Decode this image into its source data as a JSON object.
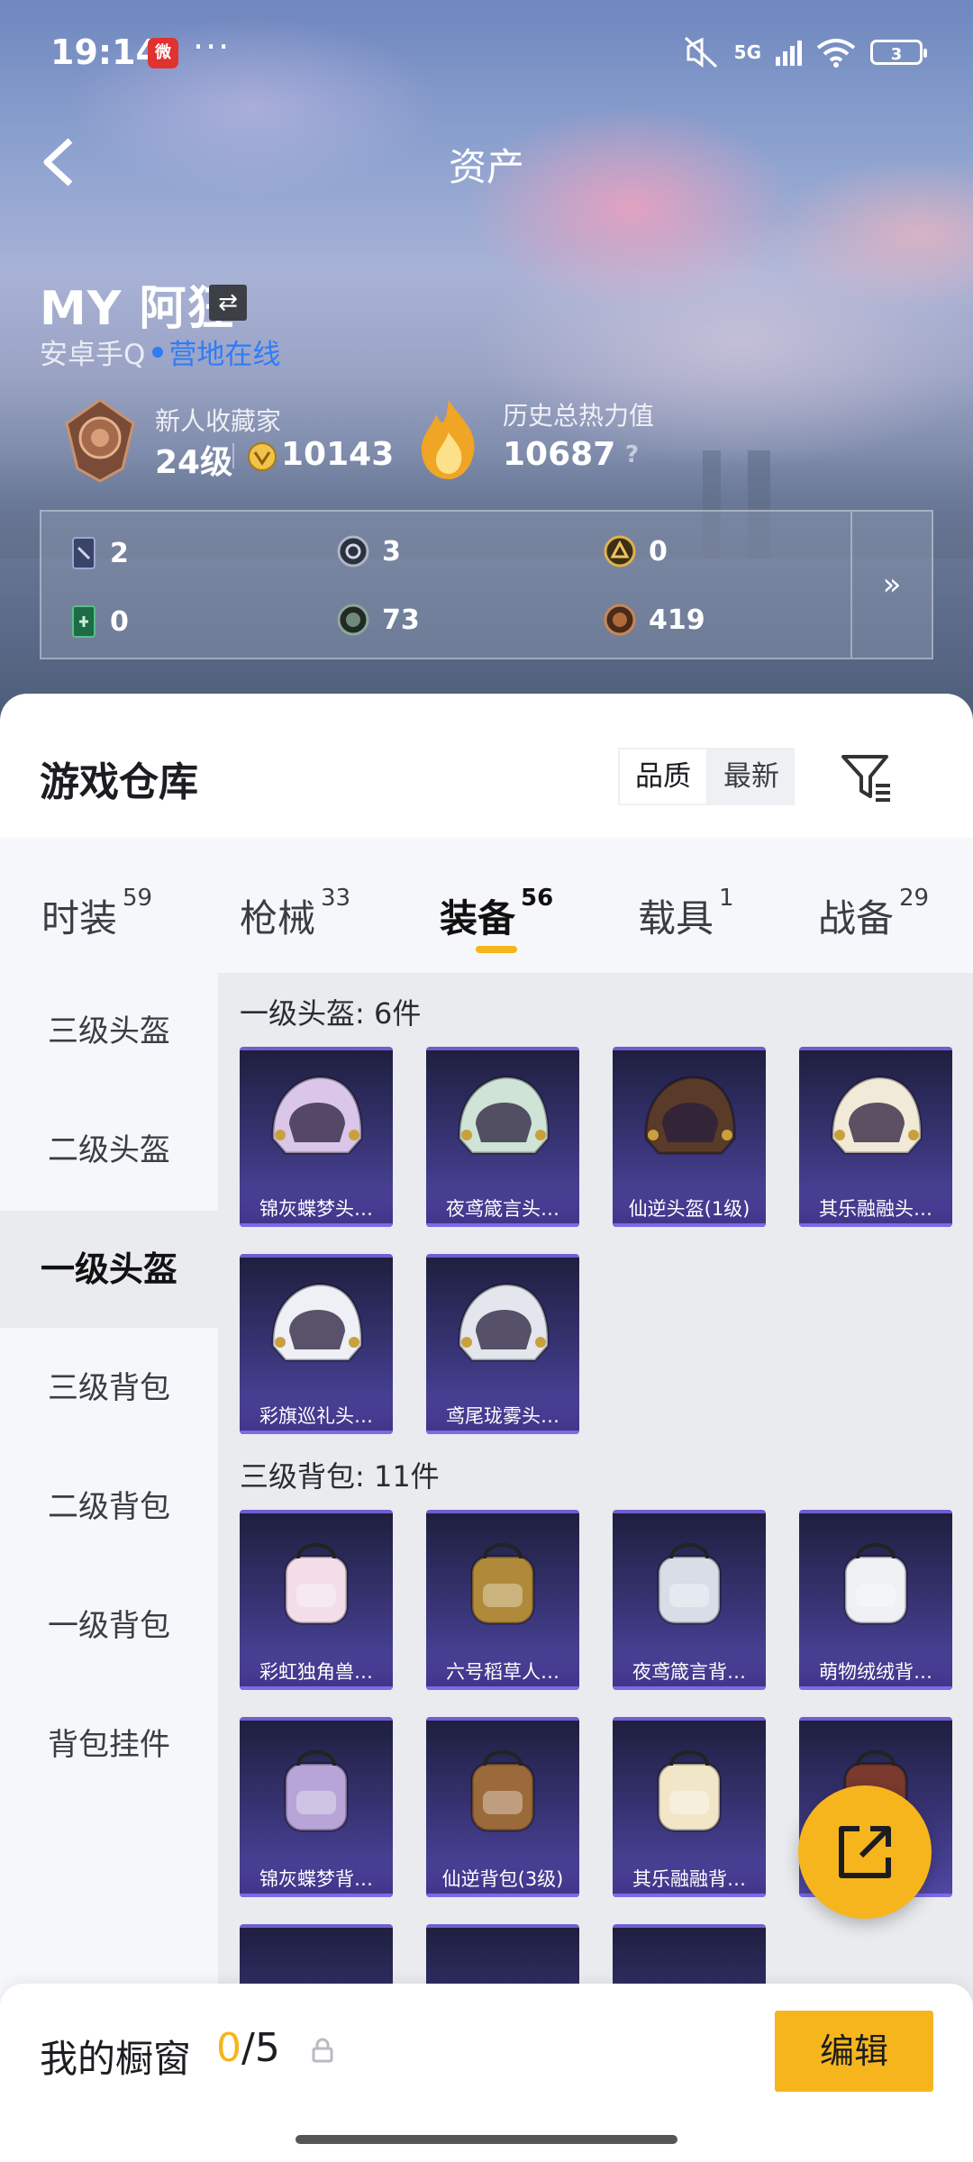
{
  "status_bar": {
    "time": "19:14",
    "network": "5G",
    "battery": "3"
  },
  "header": {
    "title": "资产"
  },
  "profile": {
    "name": "MY 阿狂",
    "platform": "安卓手Q",
    "status": "营地在线",
    "rank_title": "新人收藏家",
    "rank_level": "24级",
    "coins": "10143",
    "heat_title": "历史总热力值",
    "heat_value": "10687",
    "help": "?"
  },
  "currencies": [
    {
      "icon": "card-icon",
      "value": "2"
    },
    {
      "icon": "silver-coin-icon",
      "value": "3"
    },
    {
      "icon": "gold-coin-icon",
      "value": "0"
    },
    {
      "icon": "green-ticket-icon",
      "value": "0"
    },
    {
      "icon": "dark-coin-icon",
      "value": "73"
    },
    {
      "icon": "bronze-coin-icon",
      "value": "419"
    }
  ],
  "warehouse": {
    "title": "游戏仓库",
    "sort_options": [
      "品质",
      "最新"
    ],
    "sort_selected": "品质"
  },
  "tabs": [
    {
      "label": "时装",
      "count": "59"
    },
    {
      "label": "枪械",
      "count": "33"
    },
    {
      "label": "装备",
      "count": "56"
    },
    {
      "label": "载具",
      "count": "1"
    },
    {
      "label": "战备",
      "count": "29"
    }
  ],
  "active_tab": "装备",
  "sidebar": [
    "三级头盔",
    "二级头盔",
    "一级头盔",
    "三级背包",
    "二级背包",
    "一级背包",
    "背包挂件"
  ],
  "active_sidebar": "一级头盔",
  "sections": [
    {
      "title": "一级头盔: 6件",
      "items": [
        {
          "label": "锦灰蝶梦头…",
          "art": "helmet-icon",
          "color": "#d9c6e8"
        },
        {
          "label": "夜鸢箴言头…",
          "art": "helmet-icon",
          "color": "#cfe3d6"
        },
        {
          "label": "仙逆头盔(1级)",
          "art": "helmet-icon",
          "color": "#5a3b2a"
        },
        {
          "label": "其乐融融头…",
          "art": "helmet-icon",
          "color": "#f1ead8"
        },
        {
          "label": "彩旗巡礼头…",
          "art": "helmet-icon",
          "color": "#eef0f6"
        },
        {
          "label": "鸢尾珑雾头…",
          "art": "helmet-icon",
          "color": "#e4e6ee"
        }
      ]
    },
    {
      "title": "三级背包: 11件",
      "items": [
        {
          "label": "彩虹独角兽…",
          "art": "backpack-icon",
          "color": "#f2dde8"
        },
        {
          "label": "六号稻草人…",
          "art": "backpack-icon",
          "color": "#b08a3a"
        },
        {
          "label": "夜鸢箴言背…",
          "art": "backpack-icon",
          "color": "#d8dde8"
        },
        {
          "label": "萌物绒绒背…",
          "art": "backpack-icon",
          "color": "#eef0f4"
        },
        {
          "label": "锦灰蝶梦背…",
          "art": "backpack-icon",
          "color": "#b7a5d8"
        },
        {
          "label": "仙逆背包(3级)",
          "art": "backpack-icon",
          "color": "#9b6a3a"
        },
        {
          "label": "其乐融融背…",
          "art": "backpack-icon",
          "color": "#f2e6c8"
        },
        {
          "label": "",
          "art": "backpack-icon",
          "color": "#7b3a2e"
        }
      ]
    }
  ],
  "showcase": {
    "title": "我的橱窗",
    "current": "0",
    "total": "/5",
    "edit_label": "编辑"
  },
  "colors": {
    "accent": "#f6b51c",
    "online": "#2f7cf6",
    "card_bg": "#3a3578"
  }
}
